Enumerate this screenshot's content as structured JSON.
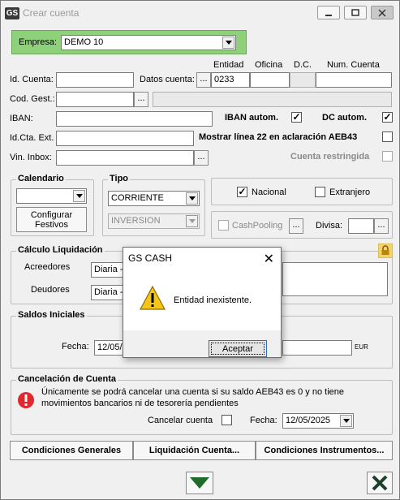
{
  "window": {
    "title": "Crear cuenta",
    "icon_text": "GS"
  },
  "empresa": {
    "label": "Empresa:",
    "value": "DEMO 10"
  },
  "cuenta_headers": {
    "entidad": "Entidad",
    "oficina": "Oficina",
    "dc": "D.C.",
    "num_cuenta": "Num. Cuenta"
  },
  "fields": {
    "id_cuenta_label": "Id. Cuenta:",
    "datos_cuenta_label": "Datos cuenta:",
    "entidad_value": "0233",
    "cod_gest_label": "Cod. Gest.:",
    "iban_label": "IBAN:",
    "iban_autom_label": "IBAN autom.",
    "dc_autom_label": "DC autom.",
    "idcta_ext_label": "Id.Cta. Ext.",
    "mostrar_linea_label": "Mostrar línea 22 en aclaración AEB43",
    "vin_inbox_label": "Vin. Inbox:",
    "cuenta_restringida_label": "Cuenta restringida",
    "dots": "..."
  },
  "calendario": {
    "title": "Calendario",
    "configurar_label": "Configurar Festivos"
  },
  "tipo": {
    "title": "Tipo",
    "value": "CORRIENTE",
    "sub_value": "INVERSION"
  },
  "nacionalidad": {
    "nacional_label": "Nacional",
    "extranjero_label": "Extranjero",
    "cashpooling_label": "CashPooling",
    "divisa_label": "Divisa:"
  },
  "calculo": {
    "title": "Cálculo Liquidación",
    "acreedores_label": "Acreedores",
    "acreedores_value": "Diaria -",
    "deudores_label": "Deudores",
    "deudores_value": "Diaria -"
  },
  "saldos": {
    "title": "Saldos Iniciales",
    "fecha_label": "Fecha:",
    "fecha_value": "12/05/",
    "currency": "EUR"
  },
  "cancelacion": {
    "title": "Cancelación de Cuenta",
    "message_line1": "Únicamente se podrá cancelar una cuenta si su saldo AEB43 es 0 y no tiene",
    "message_line2": "movimientos bancarios ni de tesorería pendientes",
    "cancelar_label": "Cancelar cuenta",
    "fecha_label": "Fecha:",
    "fecha_value": "12/05/2025"
  },
  "bottom_buttons": {
    "condiciones_generales": "Condiciones Generales",
    "liquidacion_cuenta": "Liquidación Cuenta...",
    "condiciones_instrumentos": "Condiciones Instrumentos..."
  },
  "dialog": {
    "title": "GS CASH",
    "message": "Entidad inexistente.",
    "ok_label": "Aceptar",
    "close_glyph": "✕"
  },
  "colors": {
    "empresa_bg": "#8fd17b",
    "cancel_icon": "#e0282e",
    "accept_arrow": "#1f6b2a",
    "close_x": "#1e3f2b"
  }
}
